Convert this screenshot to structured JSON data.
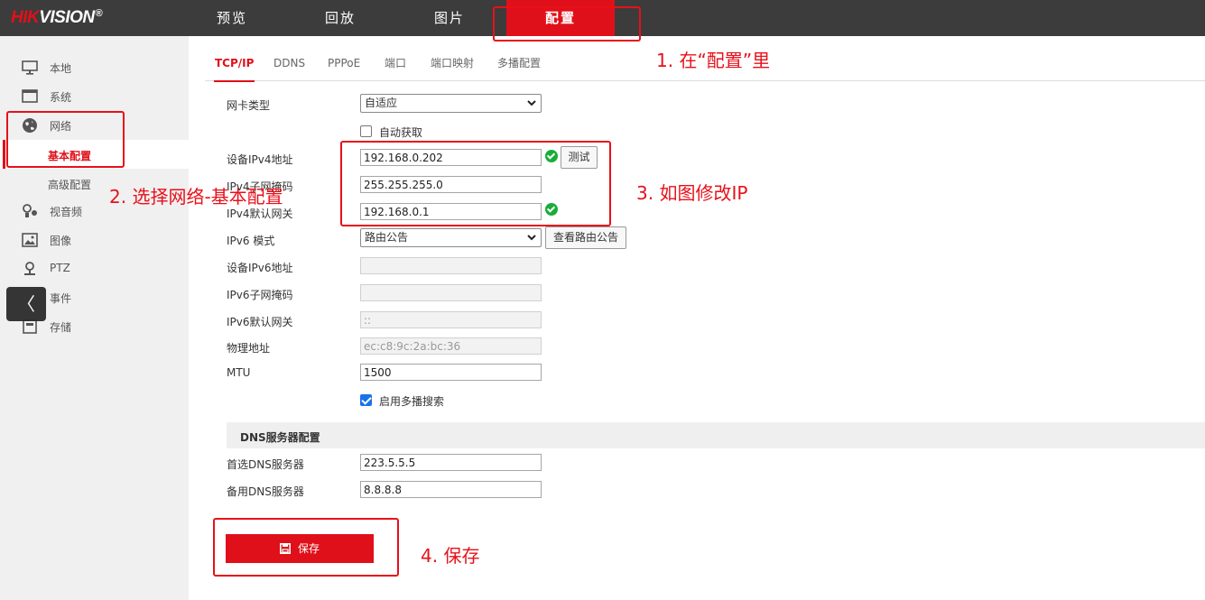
{
  "brand": {
    "hik": "HIK",
    "vision": "VISION",
    "reg": "®"
  },
  "topnav": [
    "预览",
    "回放",
    "图片",
    "配置"
  ],
  "sidebar": {
    "items": [
      {
        "label": "本地",
        "icon": "monitor-icon"
      },
      {
        "label": "系统",
        "icon": "system-window-icon"
      },
      {
        "label": "网络",
        "icon": "globe-icon"
      },
      {
        "label": "视音频",
        "icon": "audio-video-icon"
      },
      {
        "label": "图像",
        "icon": "image-icon"
      },
      {
        "label": "PTZ",
        "icon": "ptz-icon"
      },
      {
        "label": "事件",
        "icon": "event-icon"
      },
      {
        "label": "存储",
        "icon": "storage-icon"
      }
    ],
    "sub_items": [
      "基本配置",
      "高级配置"
    ],
    "collapse": "〈"
  },
  "tabs": [
    "TCP/IP",
    "DDNS",
    "PPPoE",
    "端口",
    "端口映射",
    "多播配置"
  ],
  "form": {
    "nic_type": {
      "label": "网卡类型",
      "value": "自适应"
    },
    "dhcp": {
      "label": "自动获取",
      "checked": false
    },
    "ipv4_addr": {
      "label": "设备IPv4地址",
      "value": "192.168.0.202"
    },
    "test_button": "测试",
    "ipv4_mask": {
      "label": "IPv4子网掩码",
      "value": "255.255.255.0"
    },
    "ipv4_gw": {
      "label": "IPv4默认网关",
      "value": "192.168.0.1"
    },
    "ipv6_mode": {
      "label": "IPv6 模式",
      "value": "路由公告"
    },
    "view_route_button": "查看路由公告",
    "ipv6_addr": {
      "label": "设备IPv6地址",
      "value": ""
    },
    "ipv6_mask": {
      "label": "IPv6子网掩码",
      "value": ""
    },
    "ipv6_gw": {
      "label": "IPv6默认网关",
      "value": "::"
    },
    "mac": {
      "label": "物理地址",
      "value": "ec:c8:9c:2a:bc:36"
    },
    "mtu": {
      "label": "MTU",
      "value": "1500"
    },
    "multicast": {
      "label": "启用多播搜索",
      "checked": true
    }
  },
  "dns": {
    "header": "DNS服务器配置",
    "primary": {
      "label": "首选DNS服务器",
      "value": "223.5.5.5"
    },
    "secondary": {
      "label": "备用DNS服务器",
      "value": "8.8.8.8"
    }
  },
  "save_button": "保存",
  "annotations": {
    "step1": "1. 在“配置”里",
    "step2": "2. 选择网络-基本配置",
    "step3": "3. 如图修改IP",
    "step4": "4. 保存"
  },
  "colors": {
    "accent": "#e0101a",
    "topbar": "#3c3c3c",
    "annotation": "#e8101a",
    "ok": "#1aad3a"
  }
}
